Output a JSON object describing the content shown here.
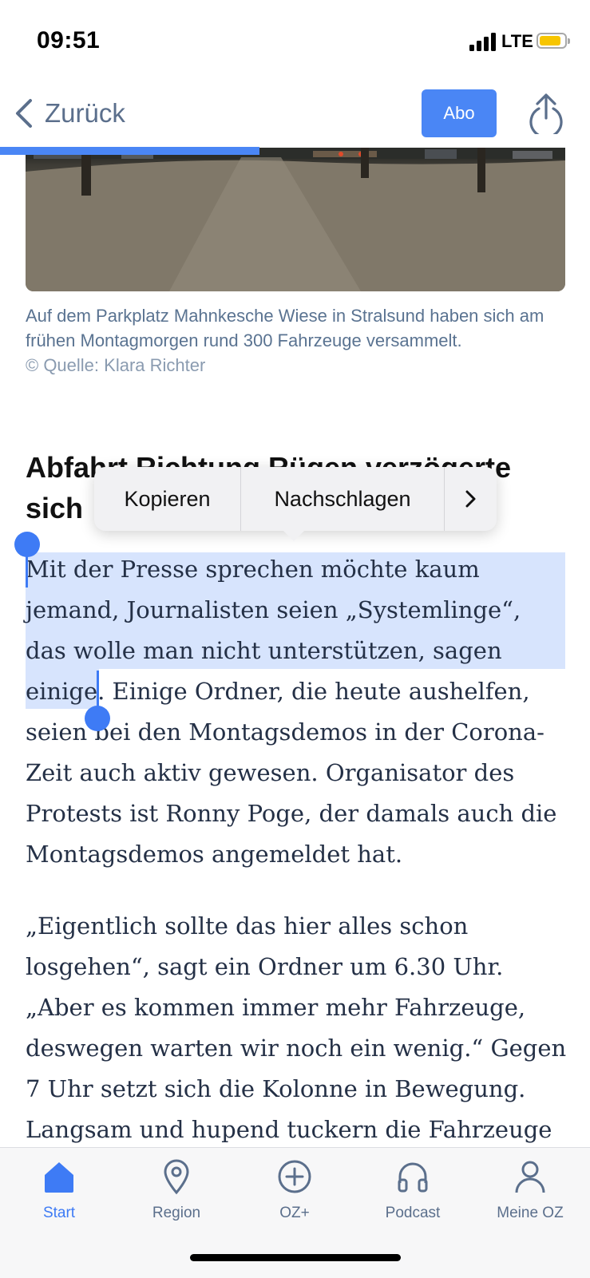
{
  "status_bar": {
    "time": "09:51",
    "network": "LTE",
    "battery_color": "#f7c500"
  },
  "nav": {
    "back_label": "Zurück",
    "subscribe_label": "Abo",
    "reading_progress": 0.44
  },
  "article": {
    "photo_caption": "Auf dem Parkplatz Mahnkesche Wiese in Stralsund haben sich am frühen Montagmorgen rund 300 Fahrzeuge versammelt.",
    "photo_credit": "© Quelle: Klara Richter",
    "subhead": "Abfahrt Richtung Rügen verzögerte sich",
    "paragraph_1": "Mit der Presse sprechen möchte kaum jemand, Journalisten seien „Systemlinge“, das wolle man nicht unterstützen, sagen einige. Einige Ordner, die heute aushelfen, seien bei den Montagsdemos in der Corona-Zeit auch aktiv gewesen. Organisator des Protests ist Ronny Poge, der damals auch die Montagsdemos angemeldet hat.",
    "paragraph_2": "„Eigentlich sollte das hier alles schon losgehen“, sagt ein Ordner um 6.30 Uhr. „Aber es kommen immer mehr Fahrzeuge, deswegen warten wir noch ein wenig.“ Gegen 7 Uhr setzt sich die Kolonne in Bewegung. Langsam und hupend tuckern die Fahrzeuge"
  },
  "context_menu": {
    "copy_label": "Kopieren",
    "lookup_label": "Nachschlagen",
    "more_icon": "chevron-right-icon"
  },
  "tab_bar": {
    "items": [
      {
        "label": "Start",
        "icon": "home-icon",
        "active": true
      },
      {
        "label": "Region",
        "icon": "location-pin-icon",
        "active": false
      },
      {
        "label": "OZ+",
        "icon": "plus-circle-icon",
        "active": false
      },
      {
        "label": "Podcast",
        "icon": "headphones-icon",
        "active": false
      },
      {
        "label": "Meine OZ",
        "icon": "person-icon",
        "active": false
      }
    ]
  },
  "colors": {
    "accent": "#4a86f5",
    "muted": "#5b6f8c",
    "selection": "#4a86f5"
  }
}
